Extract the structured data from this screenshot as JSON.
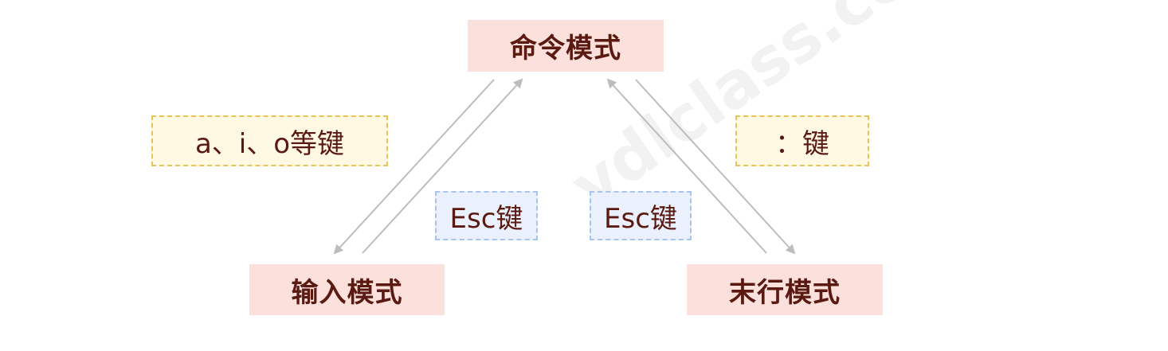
{
  "modes": {
    "command": "命令模式",
    "insert": "输入模式",
    "last_line": "末行模式"
  },
  "keys": {
    "to_insert": "a、i、o等键",
    "to_last_line": "：键",
    "esc_from_insert": "Esc键",
    "esc_from_last_line": "Esc键"
  },
  "watermark": "ydlclass.com",
  "colors": {
    "mode_fill": "#fbe0dc",
    "mode_text": "#5a1a12",
    "yellow_fill": "#fff8e2",
    "yellow_border": "#e8c35a",
    "blue_fill": "#eaf1fc",
    "blue_border": "#a9c4ec",
    "arrow": "#bdbdbd"
  }
}
